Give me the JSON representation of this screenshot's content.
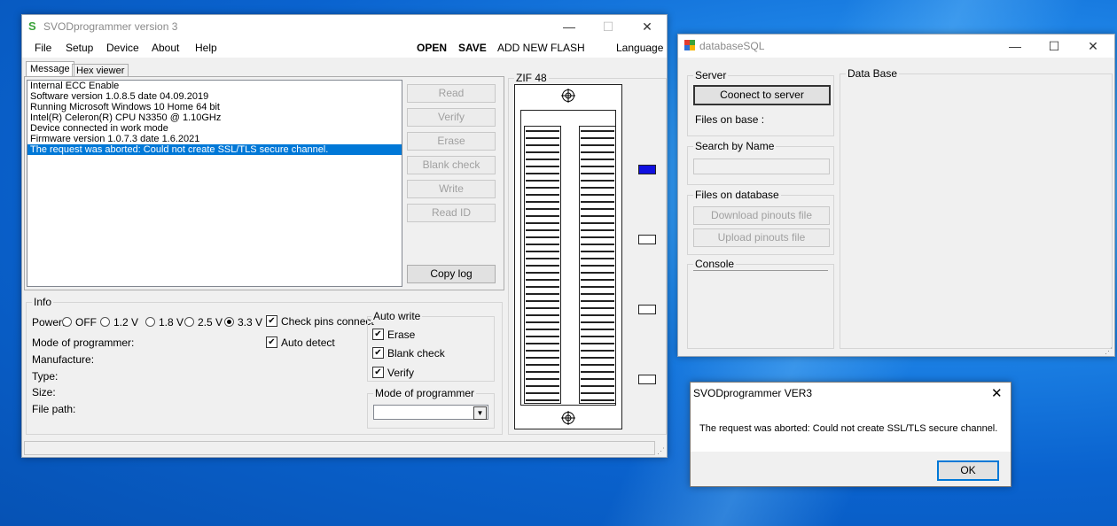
{
  "main": {
    "title": "SVODprogrammer version 3",
    "menu": [
      "File",
      "Setup",
      "Device",
      "About",
      "Help"
    ],
    "toolbar": {
      "open": "OPEN",
      "save": "SAVE",
      "add_flash": "ADD NEW FLASH",
      "language": "Language"
    },
    "tabs": [
      "Message",
      "Hex viewer"
    ],
    "log": [
      "Internal ECC Enable",
      "Software version 1.0.8.5 date 04.09.2019",
      "Running Microsoft Windows 10 Home 64 bit",
      "Intel(R) Celeron(R) CPU N3350 @ 1.10GHz",
      "Device connected in work mode",
      "Firmware version 1.0.7.3 date 1.6.2021",
      "The request was aborted: Could not create SSL/TLS secure channel."
    ],
    "selected_log_index": 6,
    "actions": [
      "Read",
      "Verify",
      "Erase",
      "Blank check",
      "Write",
      "Read ID"
    ],
    "copy_log": "Copy log",
    "zif_label": "ZIF 48",
    "info": {
      "group_label": "Info",
      "power_label": "Power:",
      "power_options": [
        "OFF",
        "1.2 V",
        "1.8 V",
        "2.5 V",
        "3.3 V"
      ],
      "power_selected": "3.3 V",
      "check_pins": "Check pins connect",
      "auto_detect": "Auto detect",
      "fields": [
        "Mode of programmer:",
        "Manufacture:",
        "Type:",
        "Size:",
        "File path:"
      ]
    },
    "auto_write": {
      "label": "Auto write",
      "items": [
        "Erase",
        "Blank check",
        "Verify"
      ]
    },
    "mode_group": {
      "label": "Mode of programmer",
      "value": ""
    }
  },
  "db": {
    "title": "databaseSQL",
    "server_group": "Server",
    "connect_btn": "Coonect to server",
    "files_on_base": "Files on base :",
    "search_group": "Search by Name",
    "search_value": "",
    "files_group": "Files on database",
    "download_btn": "Download pinouts file",
    "upload_btn": "Upload pinouts file",
    "console_group": "Console",
    "database_group": "Data Base"
  },
  "dialog": {
    "title": "SVODprogrammer VER3",
    "message": "The request was aborted: Could not create SSL/TLS secure channel.",
    "ok": "OK"
  }
}
